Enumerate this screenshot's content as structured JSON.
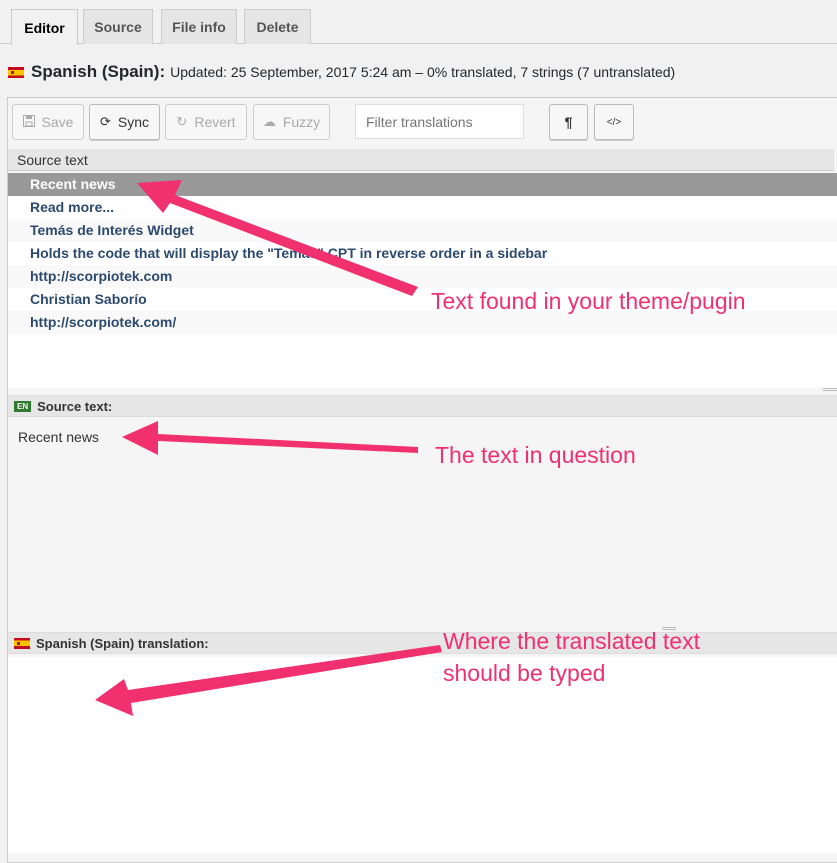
{
  "tabs": [
    {
      "label": "Editor",
      "active": true
    },
    {
      "label": "Source",
      "active": false
    },
    {
      "label": "File info",
      "active": false
    },
    {
      "label": "Delete",
      "active": false
    }
  ],
  "header": {
    "language": "Spanish (Spain):",
    "meta": "Updated: 25 September, 2017 5:24 am – 0% translated, 7 strings (7 untranslated)"
  },
  "toolbar": {
    "save_label": "Save",
    "sync_label": "Sync",
    "revert_label": "Revert",
    "fuzzy_label": "Fuzzy",
    "filter_placeholder": "Filter translations",
    "pilcrow": "¶",
    "code": "</>"
  },
  "list": {
    "header": "Source text",
    "rows": [
      "Recent news",
      "Read more...",
      "Temás de Interés Widget",
      "Holds the code that will display the \"Temas\" CPT in reverse order in a sidebar",
      "http://scorpiotek.com",
      "Christian Saborío",
      "http://scorpiotek.com/"
    ],
    "selected_index": 0
  },
  "source_panel": {
    "badge": "EN",
    "title": "Source text:",
    "text": "Recent news"
  },
  "translation_panel": {
    "title": "Spanish (Spain) translation:"
  },
  "annotations": {
    "theme_note": "Text found in your theme/pugin",
    "question_note": "The text in question",
    "typed_note_1": "Where the translated text",
    "typed_note_2": "should be typed"
  },
  "colors": {
    "annotation": "#f0306f",
    "selected_row": "#999999",
    "link_text": "#2c4a6e"
  }
}
